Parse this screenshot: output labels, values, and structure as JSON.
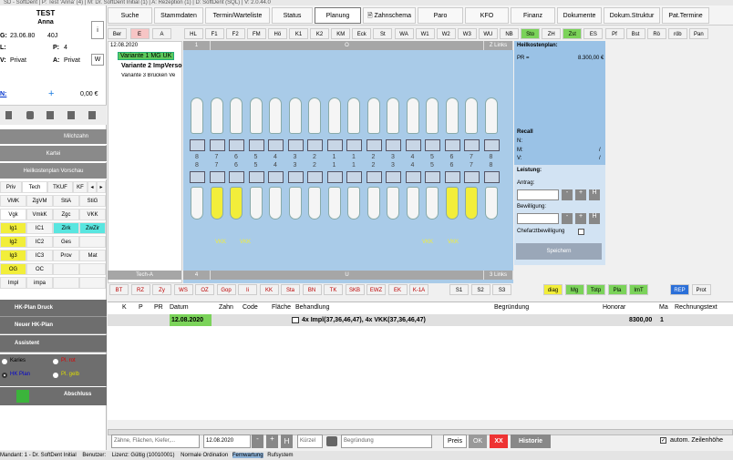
{
  "title_bar": "SD - SoftDent   |   P: Test 'Anna' (4)   |   M: Dr. SoftDent Initial (1)   |   A: Rezeption (1)   |   D: SoftDent (SQL)   |   V: 2.0.44.0",
  "patient": {
    "name1": "TEST",
    "name2": "Anna",
    "g_label": "G:",
    "dob": "23.06.80",
    "age": "40J",
    "l_label": "L:",
    "p_label": "P:",
    "p_value": "4",
    "v_label": "V:",
    "v_value": "Privat",
    "a_label": "A:",
    "a_value": "Privat",
    "w_label": "W",
    "info_btn": "i",
    "n_label": "N:",
    "plus": "+",
    "balance": "0,00 €"
  },
  "left_menu": {
    "milchzahn": "Milchzahn",
    "kartei": "Kartei",
    "hkp_vorschau": "Heilkostenplan Vorschau",
    "tabs": [
      "Priv",
      "Tech",
      "TKUF",
      "KF",
      "◂",
      "▸"
    ],
    "grid": [
      [
        "VMK",
        "ZgVM",
        "StiA",
        "StiG"
      ],
      [
        "Vgk",
        "VmkK",
        "Zgc",
        "VKK"
      ],
      [
        "Ig1",
        "IC1",
        "Zirk",
        "ZwZir"
      ],
      [
        "Ig2",
        "IC2",
        "Ges",
        ""
      ],
      [
        "Ig3",
        "IC3",
        "Prov",
        "Mat"
      ],
      [
        "OG",
        "OC",
        "",
        ""
      ],
      [
        "Impl",
        "impa",
        "",
        ""
      ]
    ],
    "hk_druck": "HK-Plan Druck",
    "neuer": "Neuer HK-Plan",
    "assistent": "Assistent",
    "radio": [
      {
        "label": "Karies",
        "color": "#000"
      },
      {
        "label": "Pl. rot",
        "color": "#d00"
      },
      {
        "label": "HK Plan",
        "color": "#00c"
      },
      {
        "label": "Pl. gelb",
        "color": "#cc0"
      }
    ],
    "abschluss": "Abschluss"
  },
  "nav": [
    "Suche",
    "Stammdaten",
    "Termin/Warteliste",
    "Status",
    "Planung",
    "Zahnschema",
    "Paro",
    "KFO",
    "Finanz",
    "Dokumente",
    "Dokum.Struktur",
    "Pat.Termine"
  ],
  "toolbar": [
    "Ber",
    "E",
    "A",
    "HL",
    "F1",
    "F2",
    "FM",
    "Hö",
    "K1",
    "K2",
    "KM",
    "Eck",
    "St",
    "WA",
    "W1",
    "W2",
    "W3",
    "WU",
    "NB",
    "Sto",
    "ZH",
    "Zst",
    "ES",
    "Pf",
    "Bst",
    "Rö",
    "röb",
    "Pan"
  ],
  "variants": {
    "date": "12.08.2020",
    "v1": "Variante 1 MG UK",
    "v2": "Variante 2 ImpVerso",
    "v3": "Variante 3  Brücken Ve"
  },
  "chart": {
    "top_left": "1",
    "top_mid": "O",
    "top_right": "Z Links",
    "bottom_left": "Tech-A",
    "bottom_4": "4",
    "bottom_mid": "U",
    "bottom_right": "3 Links",
    "upper_numbers": [
      "8",
      "7",
      "6",
      "5",
      "4",
      "3",
      "2",
      "1",
      "1",
      "2",
      "3",
      "4",
      "5",
      "6",
      "7",
      "8"
    ],
    "lower_numbers": [
      "8",
      "7",
      "6",
      "5",
      "4",
      "3",
      "2",
      "1",
      "1",
      "2",
      "3",
      "4",
      "5",
      "6",
      "7",
      "8"
    ],
    "vkk_labels": [
      "VKK",
      "VKK",
      "VKK",
      "VKK"
    ]
  },
  "hkp": {
    "title": "Heilkostenplan:",
    "pr_label": "PR =",
    "pr_value": "8.300,00 €",
    "recall": "Recall",
    "n": "N:",
    "m": "M:",
    "v": "V:",
    "slash": "/",
    "leistung": "Leistung:",
    "antrag": "Antrag:",
    "bewilligung": "Bewilligung:",
    "chefarzt": "Chefarztbewilligung",
    "speichern": "Speichern",
    "minus": "-",
    "plus": "+",
    "h": "H"
  },
  "bottom_toolbar": [
    "BT",
    "RZ",
    "Zy",
    "WS",
    "OZ",
    "Gop",
    "Ii",
    "KK",
    "Sta",
    "BN",
    "TK",
    "SKB",
    "EWZ",
    "EK",
    "K-1A",
    "S1",
    "S2",
    "S3",
    "diag",
    "Mg",
    "Totp",
    "Pla",
    "ImT",
    "REP",
    "Prot"
  ],
  "table": {
    "headers": [
      "K",
      "P",
      "PR",
      "Datum",
      "Zahn",
      "Code",
      "Fläche",
      "Behandlung",
      "Begründung",
      "Honorar",
      "Ma",
      "Rechnungstext"
    ],
    "rows": [
      {
        "datum": "12.08.2020",
        "behandlung": "4x Impl(37,36,46,47), 4x VKK(37,36,46,47)",
        "honorar": "8300,00",
        "ma": "1"
      }
    ]
  },
  "entry": {
    "teeth_placeholder": "Zähne, Flächen, Kiefer,...",
    "date": "12.08.2020",
    "kuerzel": "Kürzel",
    "begruendung": "Begründung",
    "preis": "Preis",
    "ok": "OK",
    "xx": "XX",
    "historie": "Historie",
    "autom": "autom. Zeilenhöhe"
  },
  "status": {
    "mandant": "Mandant: 1 - Dr. SoftDent Initial",
    "benutzer": "Benutzer:",
    "lizenz": "Lizenz: Gültig (10010001)",
    "ordination": "Normale Ordination",
    "fernwartung": "Fernwartung",
    "ruf": "Rufsystem"
  }
}
